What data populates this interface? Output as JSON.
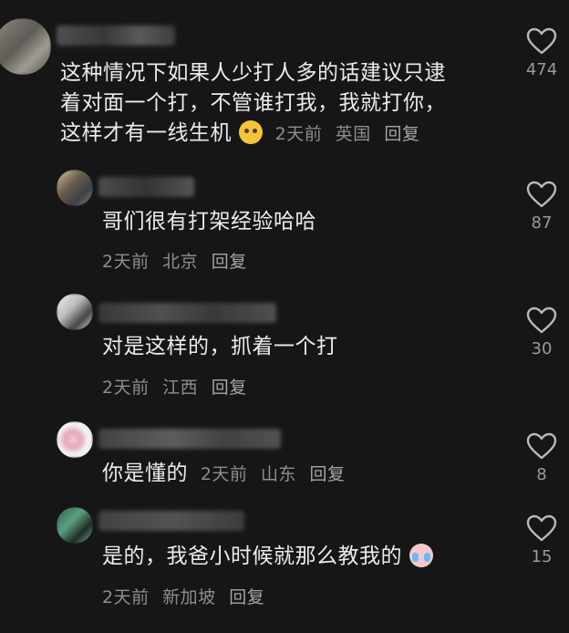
{
  "comments": [
    {
      "text_lines": [
        "这种情况下如果人少打人多的话建议只逮",
        "着对面一个打，不管谁打我，我就打你，",
        "这样才有一线生机"
      ],
      "emoji": "dog-face-emoji",
      "time": "2天前",
      "location": "英国",
      "reply": "回复",
      "likes": "474"
    },
    {
      "text_lines": [
        "哥们很有打架经验哈哈"
      ],
      "time": "2天前",
      "location": "北京",
      "reply": "回复",
      "likes": "87"
    },
    {
      "text_lines": [
        "对是这样的，抓着一个打"
      ],
      "time": "2天前",
      "location": "江西",
      "reply": "回复",
      "likes": "30"
    },
    {
      "text_lines": [
        "你是懂的"
      ],
      "time": "2天前",
      "location": "山东",
      "reply": "回复",
      "likes": "8"
    },
    {
      "text_lines": [
        "是的，我爸小时候就那么教我的"
      ],
      "emoji": "crying-face-emoji",
      "time": "2天前",
      "location": "新加坡",
      "reply": "回复",
      "likes": "15"
    }
  ],
  "colors": {
    "background": "#161616",
    "text": "#ececec",
    "meta": "#8d8d8d"
  }
}
